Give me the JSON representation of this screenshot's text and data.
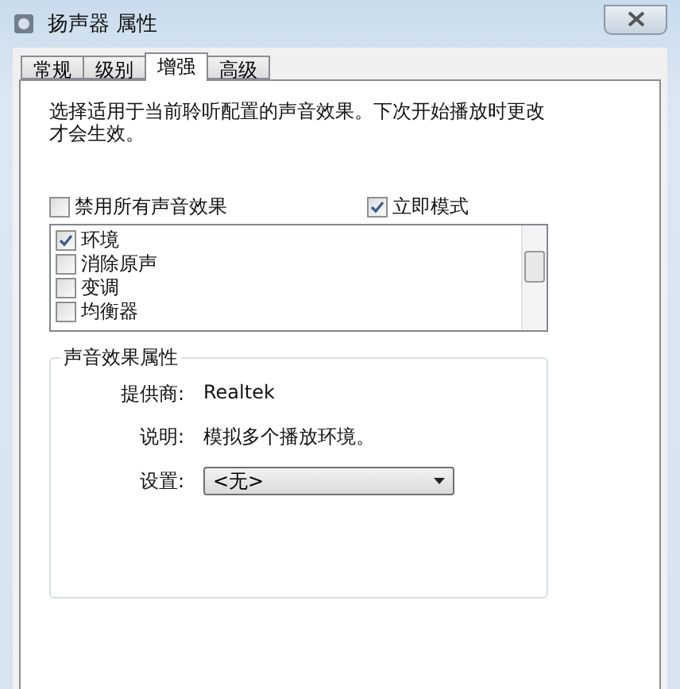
{
  "window": {
    "title": "扬声器 属性"
  },
  "tabs": [
    {
      "label": "常规",
      "selected": false
    },
    {
      "label": "级别",
      "selected": false
    },
    {
      "label": "增强",
      "selected": true
    },
    {
      "label": "高级",
      "selected": false
    }
  ],
  "intro": "选择适用于当前聆听配置的声音效果。下次开始播放时更改才会生效。",
  "options": [
    {
      "label": "禁用所有声音效果",
      "checked": false
    },
    {
      "label": "立即模式",
      "checked": true
    }
  ],
  "effects": [
    {
      "label": "环境",
      "checked": true
    },
    {
      "label": "消除原声",
      "checked": false
    },
    {
      "label": "变调",
      "checked": false
    },
    {
      "label": "均衡器",
      "checked": false
    }
  ],
  "properties": {
    "title": "声音效果属性",
    "rows": [
      {
        "label": "提供商:",
        "value": "Realtek"
      },
      {
        "label": "说明:",
        "value": "模拟多个播放环境。"
      }
    ],
    "setting": {
      "label": "设置:",
      "value": "<无>"
    }
  }
}
